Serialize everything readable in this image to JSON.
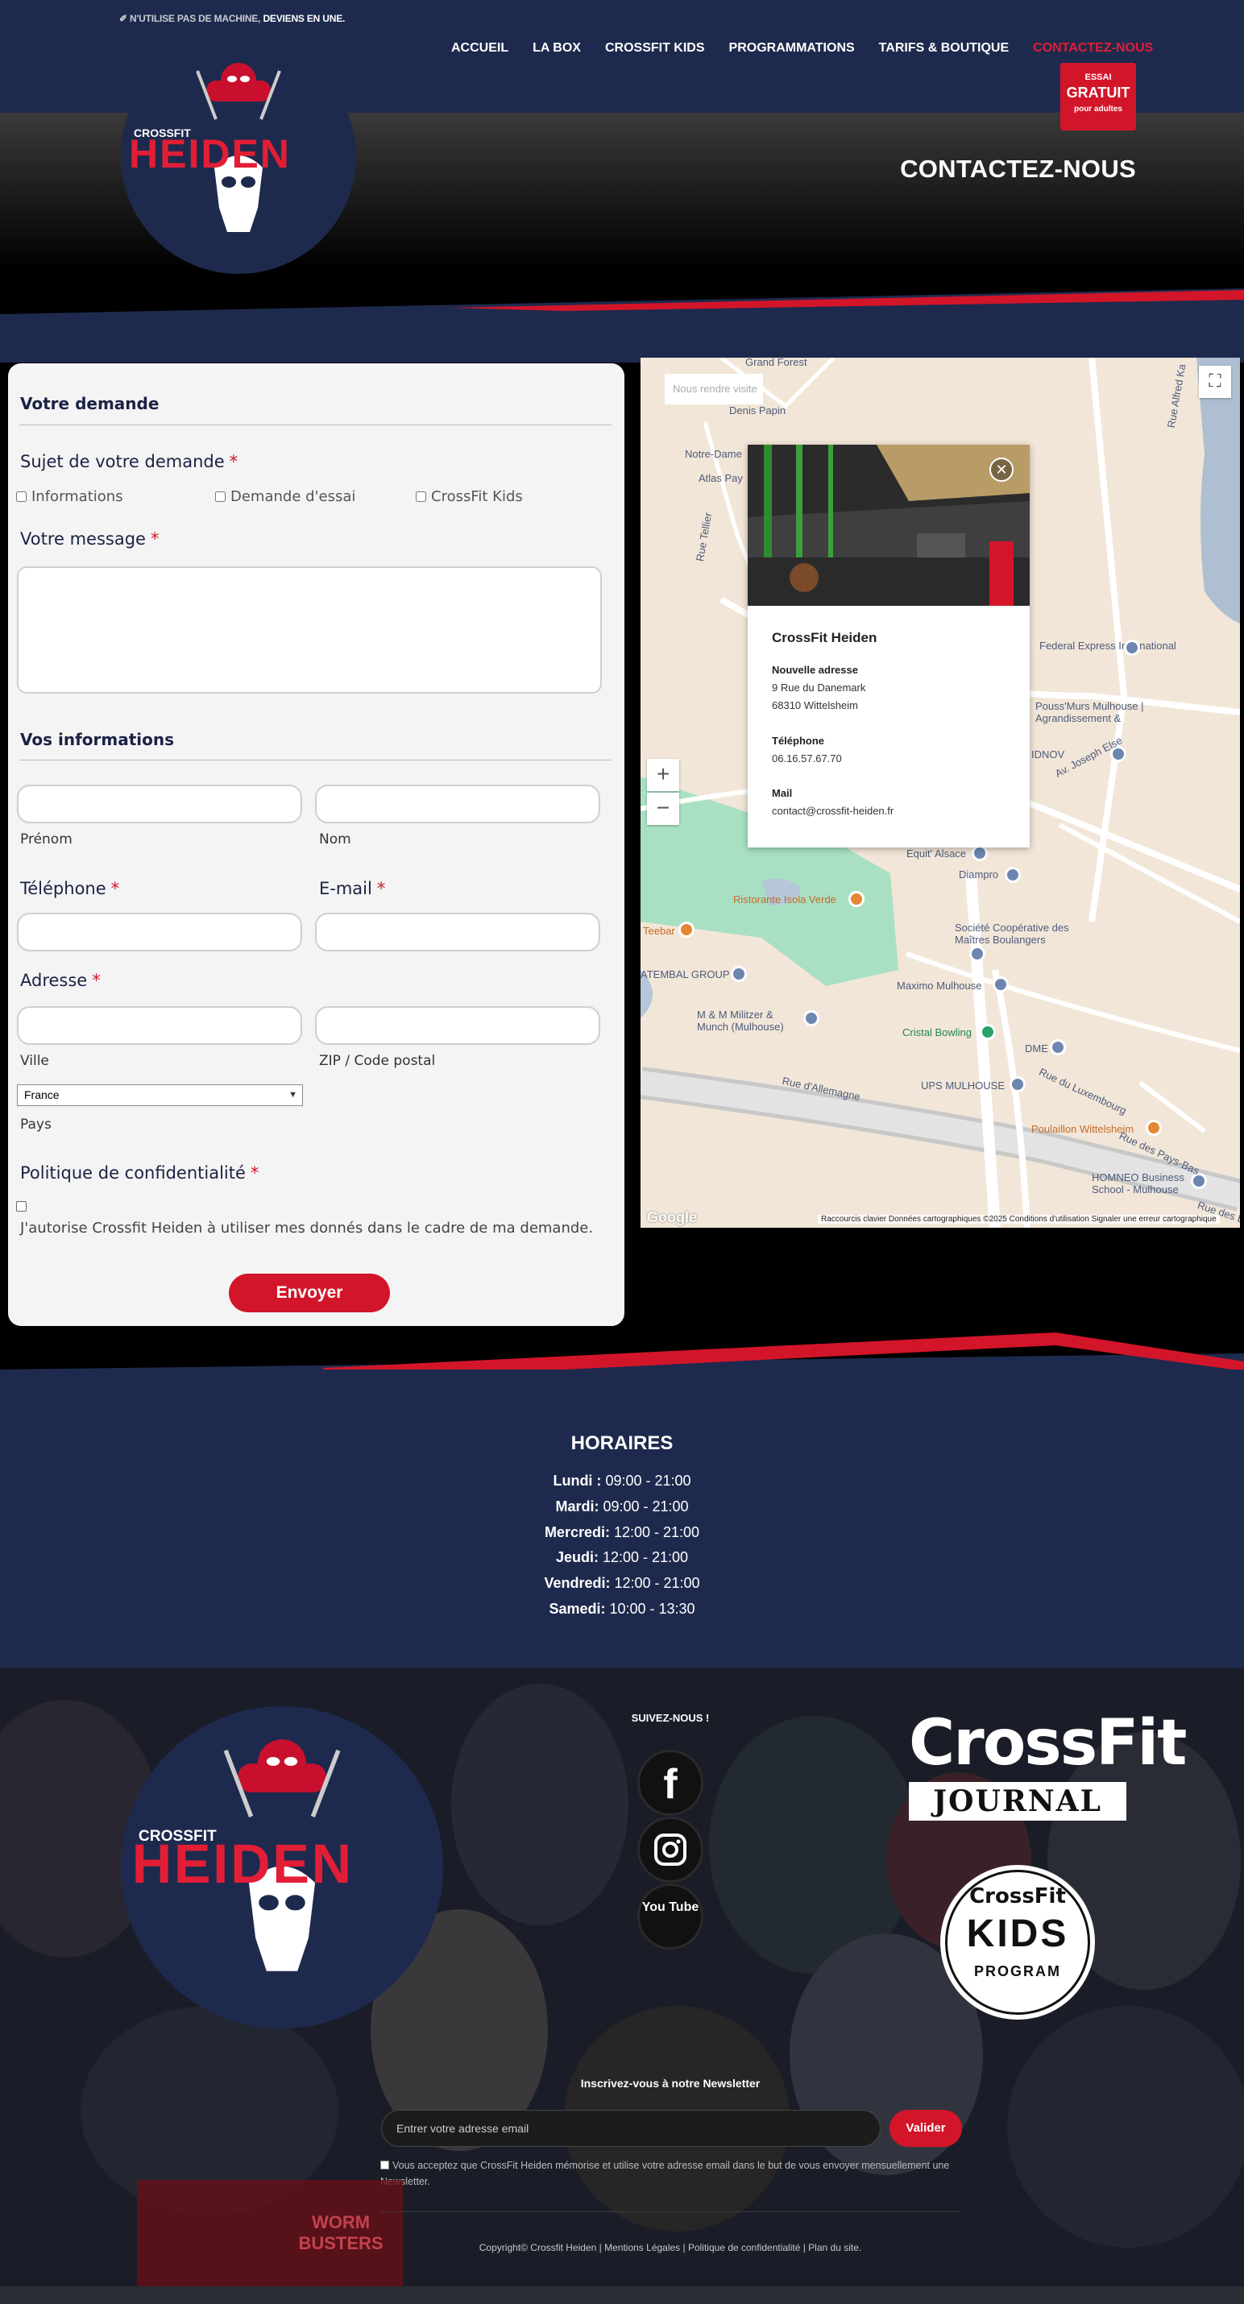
{
  "header": {
    "tagline_pre": "✐ N'UTILISE PAS DE MACHINE,",
    "tagline_bold": "DEVIENS EN UNE.",
    "logo_top": "CROSSFIT",
    "logo_main": "HEIDEN",
    "nav": [
      "ACCUEIL",
      "LA BOX",
      "CROSSFIT KIDS",
      "PROGRAMMATIONS",
      "TARIFS & BOUTIQUE",
      "CONTACTEZ-NOUS"
    ],
    "trial": {
      "line1": "ESSAI",
      "line2": "GRATUIT",
      "line3": "pour adultes"
    },
    "page_title": "CONTACTEZ-NOUS",
    "accent": "#e21e36",
    "navy": "#1e2a4d"
  },
  "form": {
    "section1": "Votre demande",
    "subject_label": "Sujet de votre demande",
    "required_mark": "*",
    "options": [
      "Informations",
      "Demande d'essai",
      "CrossFit Kids"
    ],
    "message_label": "Votre message",
    "section2": "Vos informations",
    "firstname": "Prénom",
    "lastname": "Nom",
    "phone_label": "Téléphone",
    "email_label": "E-mail",
    "address_label": "Adresse",
    "city": "Ville",
    "zip": "ZIP / Code postal",
    "country_value": "France",
    "country": "Pays",
    "privacy_label": "Politique de confidentialité",
    "consent": "J'autorise Crossfit Heiden à utiliser mes donnés dans le cadre de ma demande.",
    "submit": "Envoyer"
  },
  "map": {
    "visit_button": "Nous rendre visite",
    "zoom_in": "+",
    "zoom_out": "−",
    "popup": {
      "name": "CrossFit Heiden",
      "address_title": "Nouvelle adresse",
      "address_line1": "9 Rue du Danemark",
      "address_line2": "68310 Wittelsheim",
      "phone_title": "Téléphone",
      "phone": "06.16.57.67.70",
      "mail_title": "Mail",
      "mail": "contact@crossfit-heiden.fr"
    },
    "places": {
      "p1": "Notre-Dame",
      "p2": "Atlas Pay",
      "p3": "Federal Express International",
      "p4": "Pouss'Murs Mulhouse | Agrandissement &",
      "p5": "IDNOV",
      "p6": "Equit' Alsace",
      "p7": "Diampro",
      "p8": "Ristorante Isola Verde",
      "p9": "Teebar",
      "p10": "Société Coopérative des Maîtres Boulangers",
      "p11": "ATEMBAL GROUP",
      "p12": "Maximo Mulhouse",
      "p13": "M & M Militzer & Munch (Mulhouse)",
      "p14": "Cristal Bowling",
      "p15": "DME",
      "p16": "UPS MULHOUSE",
      "p17": "Poulaillon Wittelsheim",
      "p18": "HOMNEO Business School - Mulhouse",
      "p19": "Rue d'Allemagne",
      "p20": "Rue du Luxembourg",
      "p21": "Av. Joseph Else",
      "p22": "Rue des Pays-Bas",
      "p23": "Rue Tellier",
      "p24": "Rue Alfred Ka",
      "p25": "Rue des Bru",
      "p26": "Denis Papin",
      "p27": "Grand Forest"
    },
    "footer": "Raccourcis clavier    Données cartographiques ©2025    Conditions d'utilisation    Signaler une erreur cartographique",
    "google": "Google"
  },
  "hours": {
    "title": "HORAIRES",
    "rows": [
      {
        "day": "Lundi :",
        "time": " 09:00 - 21:00"
      },
      {
        "day": "Mardi:",
        "time": " 09:00 - 21:00"
      },
      {
        "day": "Mercredi:",
        "time": " 12:00 - 21:00"
      },
      {
        "day": "Jeudi:",
        "time": " 12:00 - 21:00"
      },
      {
        "day": "Vendredi:",
        "time": " 12:00 - 21:00"
      },
      {
        "day": "Samedi:",
        "time": " 10:00 - 13:30"
      }
    ]
  },
  "footer": {
    "follow": "SUIVEZ-NOUS !",
    "youtube_text": "You Tube",
    "crossfit_brand": "CrossFit",
    "journal": "JOURNAL",
    "kids_top": "CrossFit",
    "kids_mid": "KIDS",
    "kids_bot": "PROGRAM",
    "newsletter_title": "Inscrivez-vous à notre Newsletter",
    "email_placeholder": "Entrer votre adresse email",
    "validate": "Valider",
    "newsletter_consent": "Vous acceptez que CrossFit Heiden mémorise et utilise votre adresse email dans le but de vous envoyer mensuellement une Newsletter.",
    "copyright": "Copyright© Crossfit Heiden | Mentions Légales | Politique de confidentialité | Plan du site.",
    "poster_text": "WORM BUSTERS"
  }
}
